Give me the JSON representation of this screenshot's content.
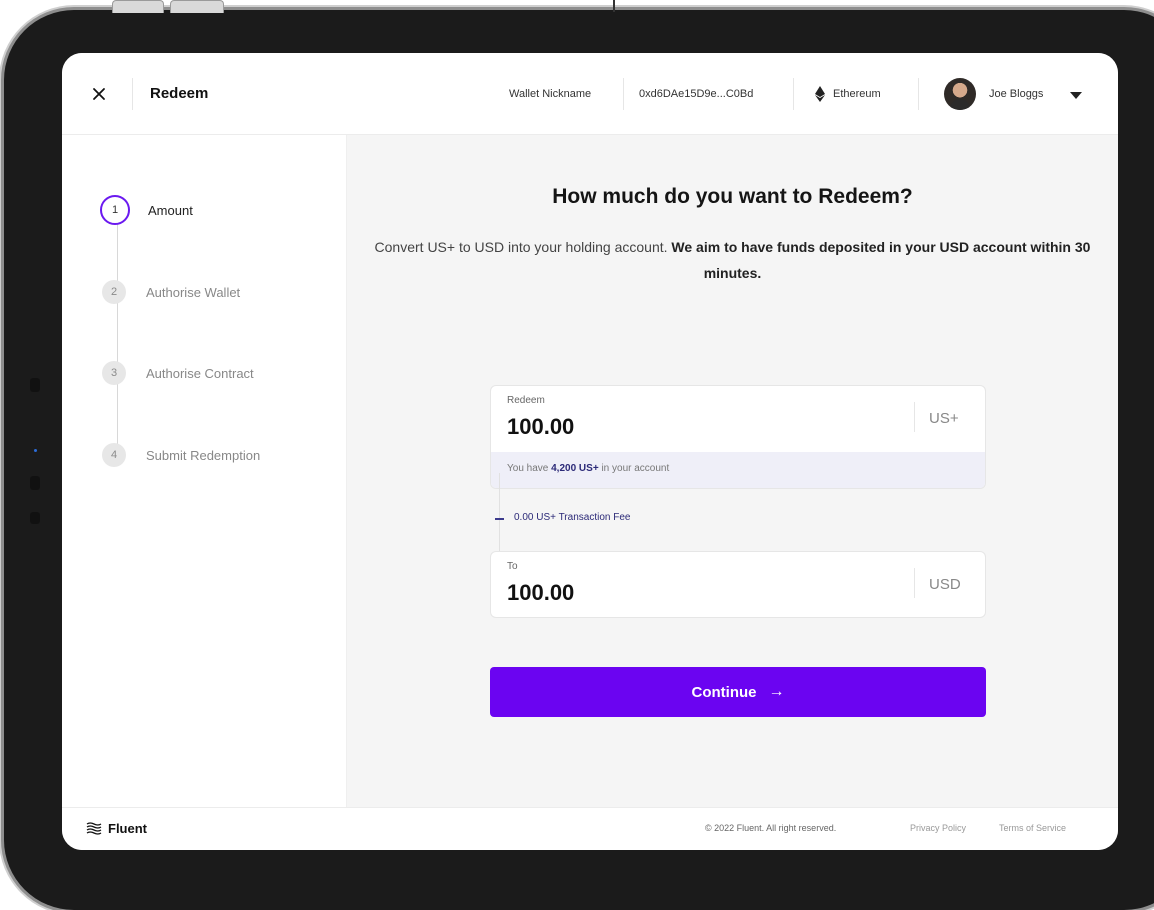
{
  "header": {
    "title": "Redeem",
    "wallet_nickname": "Wallet Nickname",
    "wallet_address": "0xd6DAe15D9e...C0Bd",
    "network": "Ethereum",
    "user_name": "Joe Bloggs"
  },
  "steps": [
    {
      "number": "1",
      "label": "Amount",
      "active": true
    },
    {
      "number": "2",
      "label": "Authorise Wallet",
      "active": false
    },
    {
      "number": "3",
      "label": "Authorise Contract",
      "active": false
    },
    {
      "number": "4",
      "label": "Submit Redemption",
      "active": false
    }
  ],
  "main": {
    "heading": "How much do you want to Redeem?",
    "subtitle_plain": "Convert US+ to USD into your holding account.",
    "subtitle_bold": "We aim to have funds deposited in your USD account within 30 minutes.",
    "redeem_field": {
      "label": "Redeem",
      "value": "100.00",
      "currency": "US+",
      "balance_prefix": "You have",
      "balance_amount": "4,200 US+",
      "balance_suffix": "in your account"
    },
    "fee_text": "0.00 US+ Transaction Fee",
    "to_field": {
      "label": "To",
      "value": "100.00",
      "currency": "USD"
    },
    "continue_label": "Continue",
    "continue_arrow": "→"
  },
  "footer": {
    "brand": "Fluent",
    "copyright": "© 2022 Fluent. All right reserved.",
    "privacy": "Privacy Policy",
    "terms": "Terms of Service"
  },
  "colors": {
    "accent": "#6b04f1",
    "balance_bg": "#efeff8",
    "link_navy": "#2c2a78"
  }
}
